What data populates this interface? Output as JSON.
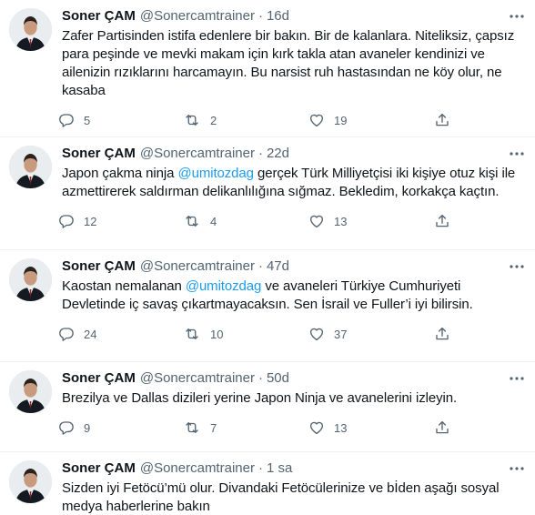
{
  "tweets": [
    {
      "name": "Soner ÇAM",
      "handle": "@Sonercamtrainer",
      "separator": "·",
      "time": "16d",
      "text": "Zafer Partisinden istifa edenlere bir bakın. Bir de kalanlara. Niteliksiz, çapsız para peşinde ve mevki makam için kırk takla atan avaneler kendinizi ve ailenizin rızıklarını harcamayın. Bu narsist ruh hastasından ne köy olur, ne kasaba",
      "replies": "5",
      "retweets": "2",
      "likes": "19"
    },
    {
      "name": "Soner ÇAM",
      "handle": "@Sonercamtrainer",
      "separator": "·",
      "time": "22d",
      "text_before": "Japon çakma ninja ",
      "mention": "@umitozdag",
      "text_after": " gerçek Türk Milliyetçisi iki kişiye otuz kişi ile azmettirerek saldırman delikanlılığına sığmaz. Bekledim, korkakça kaçtın.",
      "replies": "12",
      "retweets": "4",
      "likes": "13"
    },
    {
      "name": "Soner ÇAM",
      "handle": "@Sonercamtrainer",
      "separator": "·",
      "time": "47d",
      "text_before": "Kaostan nemalanan ",
      "mention": "@umitozdag",
      "text_after": " ve avaneleri Türkiye Cumhuriyeti Devletinde iç savaş çıkartmayacaksın. Sen İsrail ve Fuller’i iyi bilirsin.",
      "replies": "24",
      "retweets": "10",
      "likes": "37"
    },
    {
      "name": "Soner ÇAM",
      "handle": "@Sonercamtrainer",
      "separator": "·",
      "time": "50d",
      "text": "Brezilya ve Dallas dizileri yerine Japon Ninja ve avanelerini izleyin.",
      "replies": "9",
      "retweets": "7",
      "likes": "13"
    },
    {
      "name": "Soner ÇAM",
      "handle": "@Sonercamtrainer",
      "separator": "·",
      "time": "1 sa",
      "text": "Sizden iyi Fetöcü’mü olur. Divandaki Fetöcülerinize ve bİden aşağı sosyal medya haberlerine  bakın"
    }
  ],
  "colors": {
    "accent": "#1d9bf0",
    "text": "#0f1419",
    "muted": "#536471",
    "divider": "#eff3f4"
  },
  "icons": [
    "avatar",
    "more-icon",
    "reply-icon",
    "retweet-icon",
    "like-icon",
    "share-icon"
  ]
}
